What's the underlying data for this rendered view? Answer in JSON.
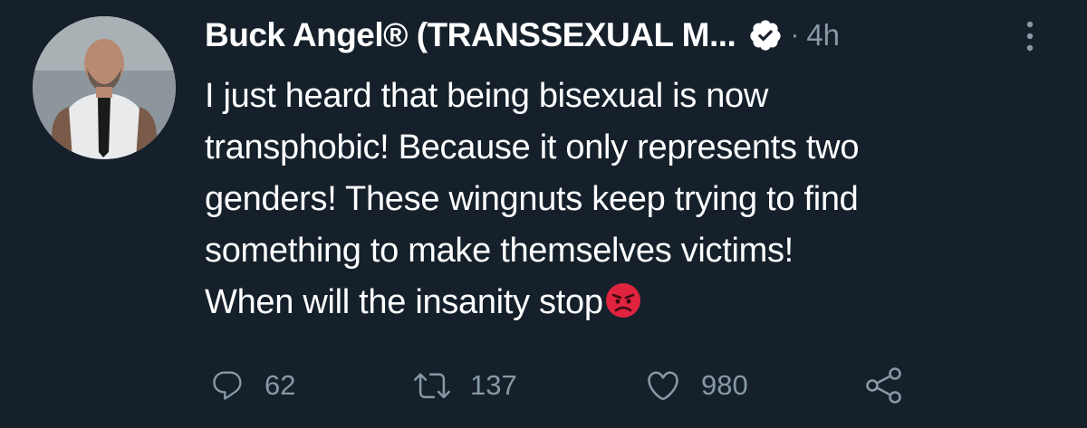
{
  "tweet": {
    "author_name": "Buck Angel® (TRANSSEXUAL M...",
    "separator": "·",
    "time": "4h",
    "verified_icon": "verified-badge-icon",
    "more_icon": "more-vertical-icon",
    "text_lines": [
      "I just heard that being bisexual is now",
      "transphobic! Because it only represents two",
      "genders! These wingnuts keep trying to find",
      "something to make themselves victims!",
      "When will the insanity stop"
    ],
    "emoji": "angry-face-emoji"
  },
  "actions": {
    "reply": {
      "icon": "reply-icon",
      "count": "62"
    },
    "retweet": {
      "icon": "retweet-icon",
      "count": "137"
    },
    "like": {
      "icon": "heart-icon",
      "count": "980"
    },
    "share": {
      "icon": "share-icon"
    }
  },
  "colors": {
    "background": "#15202b",
    "text": "#ffffff",
    "secondary": "#8899a6",
    "emoji": "#e0243f"
  }
}
